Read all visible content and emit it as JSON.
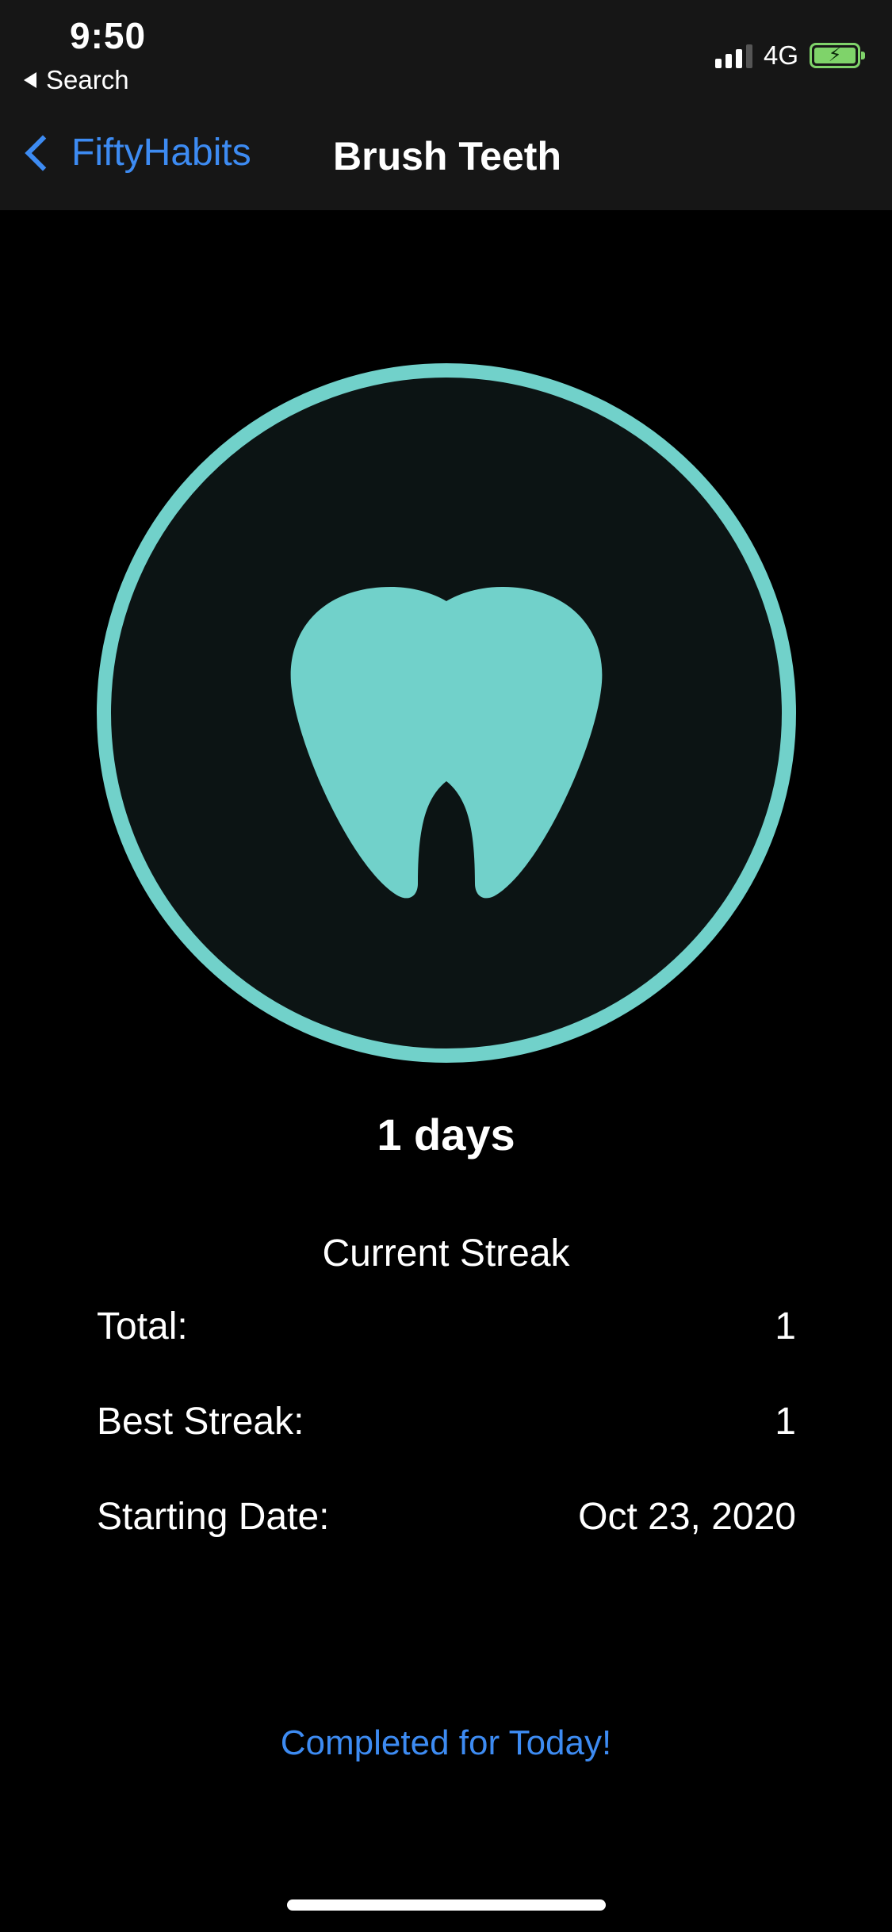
{
  "status_bar": {
    "time": "9:50",
    "back_app": "Search",
    "network": "4G",
    "signal_bars": 3,
    "battery_color": "#7fd36a"
  },
  "nav": {
    "back_label": "FiftyHabits",
    "title": "Brush Teeth"
  },
  "habit": {
    "icon": "tooth-icon",
    "accent_color": "#71d1ca",
    "streak_value": "1 days",
    "streak_label": "Current Streak"
  },
  "stats": [
    {
      "label": "Total:",
      "value": "1"
    },
    {
      "label": "Best Streak:",
      "value": "1"
    },
    {
      "label": "Starting Date:",
      "value": "Oct 23, 2020"
    }
  ],
  "action": {
    "label": "Completed for Today!",
    "color": "#3d8bf2"
  }
}
